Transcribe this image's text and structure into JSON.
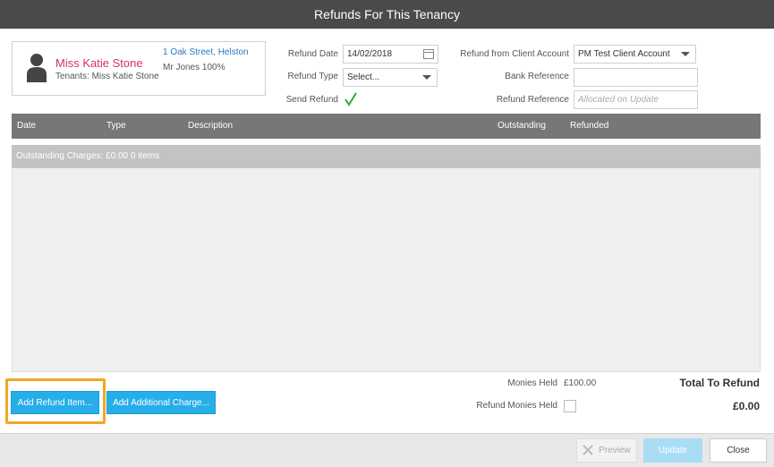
{
  "window": {
    "title": "Refunds For This Tenancy"
  },
  "tenant": {
    "name": "Miss Katie Stone",
    "tenants": "Tenants: Miss Katie Stone",
    "address": "1 Oak Street, Helston",
    "landlord": "Mr Jones 100%",
    "icon": "person-silhouette-icon"
  },
  "form": {
    "refund_date_label": "Refund Date",
    "refund_date_value": "14/02/2018",
    "refund_type_label": "Refund Type",
    "refund_type_value": "Select...",
    "send_refund_label": "Send Refund",
    "send_refund_checked": true,
    "client_account_label": "Refund from Client Account",
    "client_account_value": "PM Test Client Account",
    "bank_reference_label": "Bank Reference",
    "bank_reference_value": "",
    "refund_reference_label": "Refund Reference",
    "refund_reference_placeholder": "Allocated on Update"
  },
  "grid": {
    "columns": [
      "Date",
      "Type",
      "Description",
      "Outstanding",
      "Refunded"
    ],
    "group_label": "Outstanding Charges: £0.00 0 items",
    "rows": []
  },
  "actions": {
    "add_refund_item": "Add Refund Item...",
    "add_additional_charge": "Add Additional Charge..."
  },
  "summary": {
    "monies_held_label": "Monies Held",
    "monies_held_value": "£100.00",
    "refund_monies_held_label": "Refund Monies Held",
    "refund_monies_held_checked": false,
    "total_label": "Total To Refund",
    "total_value": "£0.00"
  },
  "footer": {
    "preview_label": "Preview",
    "update_label": "Update",
    "close_label": "Close"
  },
  "colors": {
    "title_bar": "#4a4a4a",
    "tenant_name": "#d1345e",
    "link": "#2b79c2",
    "accent_button": "#27aee9",
    "highlight": "#f5a623"
  }
}
